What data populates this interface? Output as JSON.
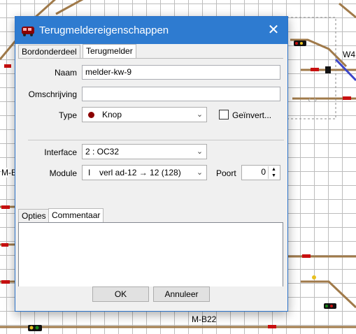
{
  "window": {
    "title": "Terugmeldereigenschappen",
    "close_glyph": "✕"
  },
  "tabs": [
    {
      "label": "Bordonderdeel"
    },
    {
      "label": "Terugmelder",
      "active": true
    }
  ],
  "form": {
    "naam_label": "Naam",
    "naam_value": "melder-kw-9",
    "omschrijving_label": "Omschrijving",
    "omschrijving_value": "",
    "type_label": "Type",
    "type_value": "Knop",
    "inverted_label": "Geïnvert...",
    "inverted_checked": false,
    "interface_label": "Interface",
    "interface_value": "2 : OC32",
    "module_label": "Module",
    "module_prefix": "I",
    "module_value": "verl ad-12 → 12 (128)",
    "poort_label": "Poort",
    "poort_value": "0"
  },
  "subtabs": [
    {
      "label": "Opties"
    },
    {
      "label": "Commentaar",
      "active": true
    }
  ],
  "comment_text": "",
  "buttons": {
    "ok": "OK",
    "cancel": "Annuleer"
  },
  "background": {
    "labels": [
      "W4",
      "M-B",
      "M-B22"
    ]
  },
  "colors": {
    "titlebar": "#2e7bd0",
    "track": "#a07a4a",
    "grid": "#bdbdbd",
    "signal_red": "#c81010",
    "signal_green": "#1a8a1a"
  }
}
